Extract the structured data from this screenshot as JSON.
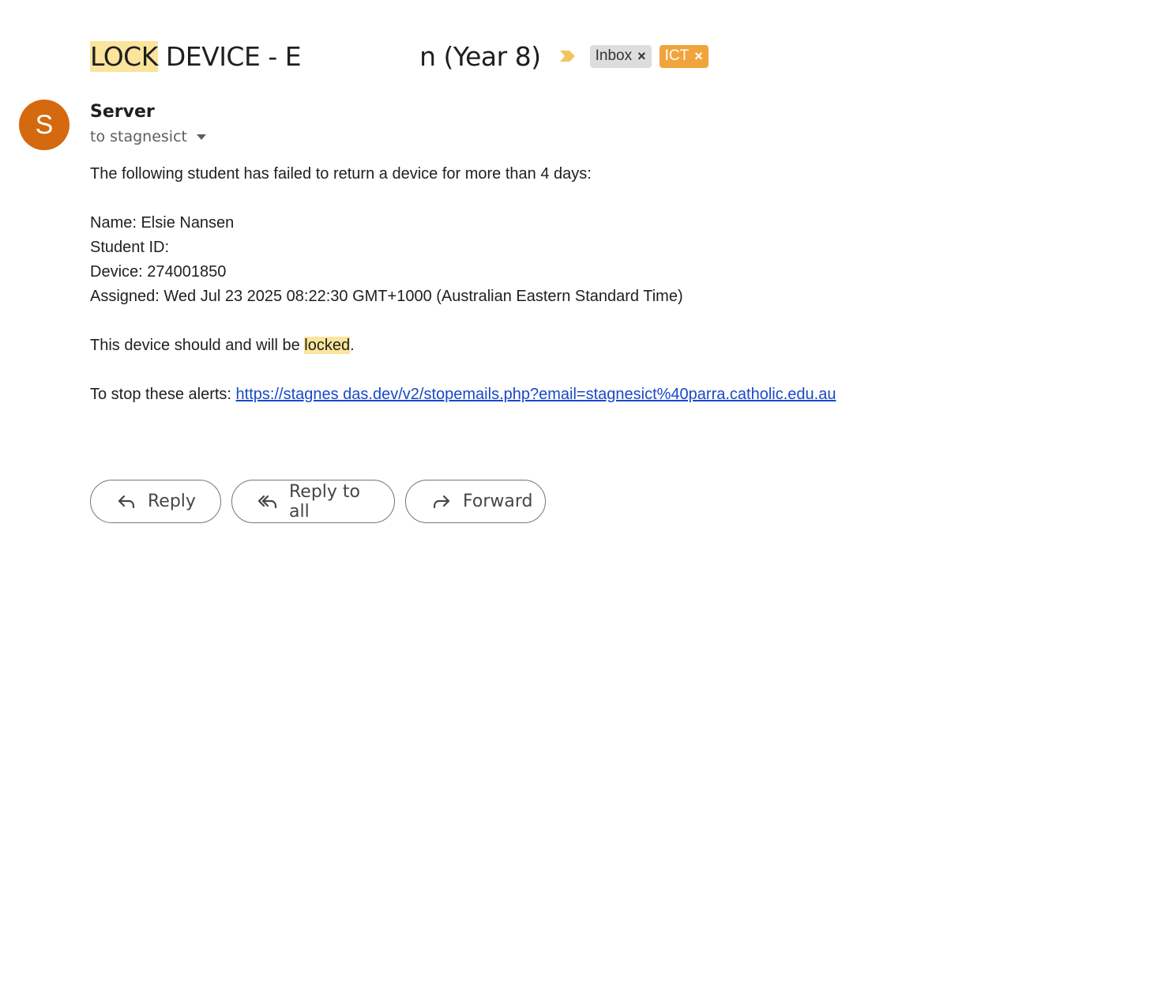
{
  "subject": {
    "highlight": "LOCK",
    "rest": " DEVICE - E",
    "tail": "n (Year 8)"
  },
  "labels": [
    {
      "name": "Inbox",
      "color": "#dddddd"
    },
    {
      "name": "ICT",
      "color": "#f0a43c"
    }
  ],
  "sender": {
    "initial": "S",
    "name": "Server",
    "recipient": "to stagnesict",
    "avatar_color": "#d4690f"
  },
  "body": {
    "intro": "The following student has failed to return a device for more than 4 days:",
    "name_line": "Name: Elsie Nansen",
    "student_id_line": "Student ID:",
    "device_line": "Device: 274001850",
    "assigned_line": "Assigned: Wed Jul 23 2025 08:22:30 GMT+1000 (Australian Eastern Standard Time)",
    "lock_prefix": "This device should and will be ",
    "lock_word": "locked",
    "lock_suffix": ".",
    "alerts_prefix": "To stop these alerts: ",
    "alerts_link": "https://stagnes das.dev/v2/stopemails.php?email=stagnesict%40parra.catholic.edu.au"
  },
  "actions": {
    "reply": "Reply",
    "reply_all": "Reply to all",
    "forward": "Forward"
  }
}
